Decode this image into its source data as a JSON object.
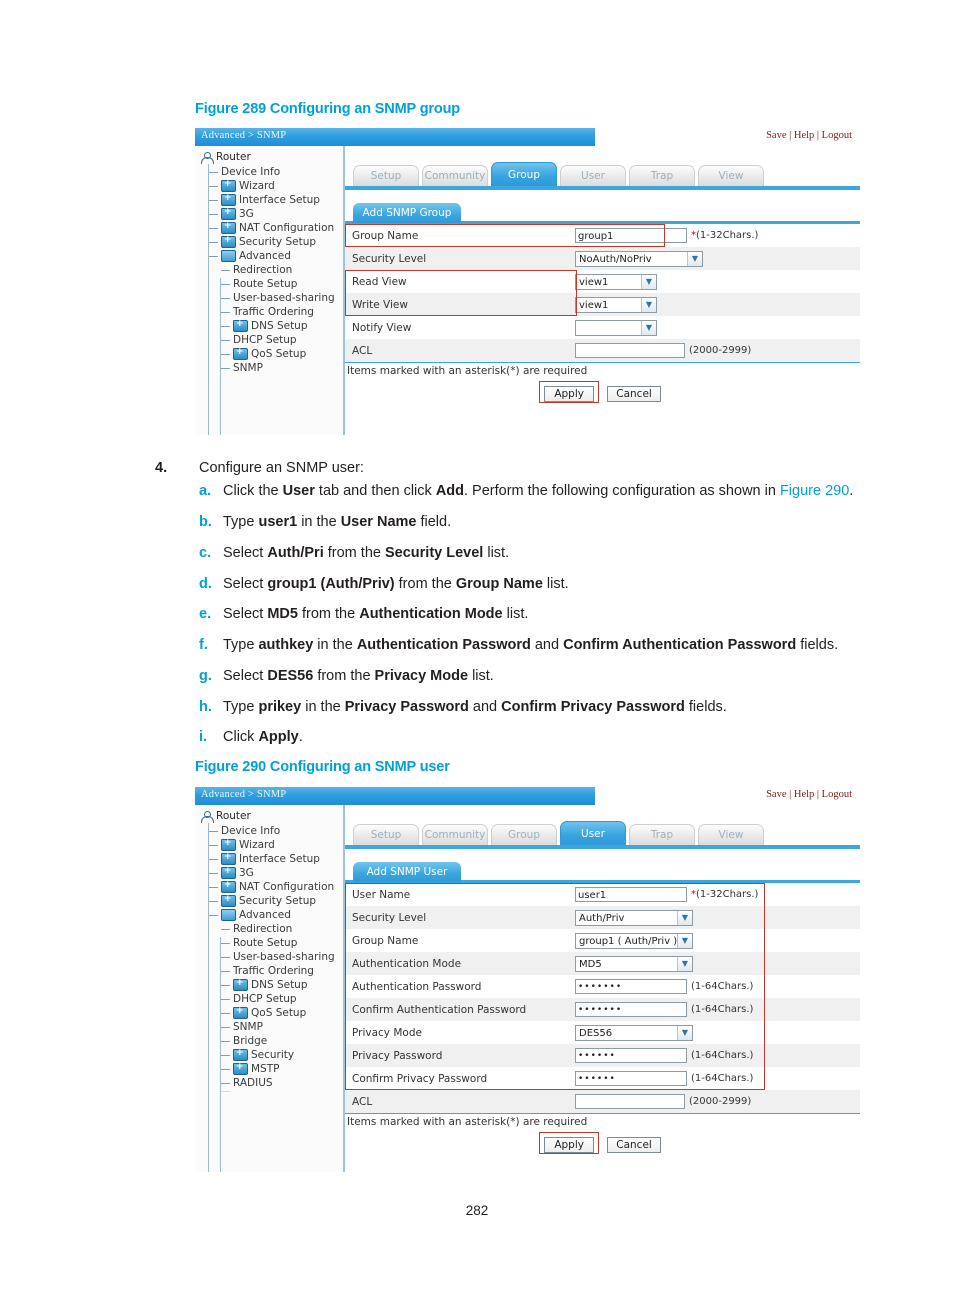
{
  "page": {
    "number": "282"
  },
  "figures": [
    {
      "caption": "Figure 289 Configuring an SNMP group",
      "breadcrumb": "Advanced > SNMP",
      "links": [
        "Save",
        "Help",
        "Logout"
      ],
      "link_separator": "|",
      "nav": {
        "root": "Router",
        "items": [
          {
            "label": "Device Info",
            "icon": "dash",
            "level": 1
          },
          {
            "label": "Wizard",
            "icon": "folder-plus",
            "level": 1
          },
          {
            "label": "Interface Setup",
            "icon": "folder-plus",
            "level": 1
          },
          {
            "label": "3G",
            "icon": "folder-plus",
            "level": 1
          },
          {
            "label": "NAT Configuration",
            "icon": "folder-plus",
            "level": 1
          },
          {
            "label": "Security Setup",
            "icon": "folder-plus",
            "level": 1
          },
          {
            "label": "Advanced",
            "icon": "folder-open",
            "level": 1
          },
          {
            "label": "Redirection",
            "icon": "dash",
            "level": 2
          },
          {
            "label": "Route Setup",
            "icon": "dash",
            "level": 2
          },
          {
            "label": "User-based-sharing",
            "icon": "dash",
            "level": 2
          },
          {
            "label": "Traffic Ordering",
            "icon": "dash",
            "level": 2
          },
          {
            "label": "DNS Setup",
            "icon": "folder-plus",
            "level": 2
          },
          {
            "label": "DHCP Setup",
            "icon": "dash",
            "level": 2
          },
          {
            "label": "QoS Setup",
            "icon": "folder-plus",
            "level": 2
          },
          {
            "label": "SNMP",
            "icon": "dash",
            "level": 2
          }
        ]
      },
      "tabs": [
        {
          "label": "Setup",
          "active": false
        },
        {
          "label": "Community",
          "active": false
        },
        {
          "label": "Group",
          "active": true
        },
        {
          "label": "User",
          "active": false
        },
        {
          "label": "Trap",
          "active": false
        },
        {
          "label": "View",
          "active": false
        }
      ],
      "subtab": "Add SNMP Group",
      "fields": [
        {
          "label": "Group Name",
          "type": "text",
          "value": "group1",
          "hint": "*(1-32Chars.)",
          "required": true
        },
        {
          "label": "Security Level",
          "type": "select",
          "value": "NoAuth/NoPriv",
          "hint": ""
        },
        {
          "label": "Read View",
          "type": "select",
          "value": "view1",
          "hint": ""
        },
        {
          "label": "Write View",
          "type": "select",
          "value": "view1",
          "hint": ""
        },
        {
          "label": "Notify View",
          "type": "select",
          "value": "",
          "hint": ""
        },
        {
          "label": "ACL",
          "type": "text",
          "value": "",
          "hint": "(2000-2999)"
        }
      ],
      "note": "Items marked with an asterisk(*) are required",
      "buttons": [
        {
          "label": "Apply",
          "highlighted": true
        },
        {
          "label": "Cancel",
          "highlighted": false
        }
      ]
    },
    {
      "caption": "Figure 290 Configuring an SNMP user",
      "breadcrumb": "Advanced > SNMP",
      "links": [
        "Save",
        "Help",
        "Logout"
      ],
      "link_separator": "|",
      "nav": {
        "root": "Router",
        "items": [
          {
            "label": "Device Info",
            "icon": "dash",
            "level": 1
          },
          {
            "label": "Wizard",
            "icon": "folder-plus",
            "level": 1
          },
          {
            "label": "Interface Setup",
            "icon": "folder-plus",
            "level": 1
          },
          {
            "label": "3G",
            "icon": "folder-plus",
            "level": 1
          },
          {
            "label": "NAT Configuration",
            "icon": "folder-plus",
            "level": 1
          },
          {
            "label": "Security Setup",
            "icon": "folder-plus",
            "level": 1
          },
          {
            "label": "Advanced",
            "icon": "folder-open",
            "level": 1
          },
          {
            "label": "Redirection",
            "icon": "dash",
            "level": 2
          },
          {
            "label": "Route Setup",
            "icon": "dash",
            "level": 2
          },
          {
            "label": "User-based-sharing",
            "icon": "dash",
            "level": 2
          },
          {
            "label": "Traffic Ordering",
            "icon": "dash",
            "level": 2
          },
          {
            "label": "DNS Setup",
            "icon": "folder-plus",
            "level": 2
          },
          {
            "label": "DHCP Setup",
            "icon": "dash",
            "level": 2
          },
          {
            "label": "QoS Setup",
            "icon": "folder-plus",
            "level": 2
          },
          {
            "label": "SNMP",
            "icon": "dash",
            "level": 2
          },
          {
            "label": "Bridge",
            "icon": "dash",
            "level": 2
          },
          {
            "label": "Security",
            "icon": "folder-plus",
            "level": 2
          },
          {
            "label": "MSTP",
            "icon": "folder-plus",
            "level": 2
          },
          {
            "label": "RADIUS",
            "icon": "dash",
            "level": 2
          }
        ]
      },
      "tabs": [
        {
          "label": "Setup",
          "active": false
        },
        {
          "label": "Community",
          "active": false
        },
        {
          "label": "Group",
          "active": false
        },
        {
          "label": "User",
          "active": true
        },
        {
          "label": "Trap",
          "active": false
        },
        {
          "label": "View",
          "active": false
        }
      ],
      "subtab": "Add SNMP User",
      "fields": [
        {
          "label": "User Name",
          "type": "text",
          "value": "user1",
          "hint": "*(1-32Chars.)",
          "required": true
        },
        {
          "label": "Security Level",
          "type": "select",
          "value": "Auth/Priv",
          "hint": ""
        },
        {
          "label": "Group Name",
          "type": "select",
          "value": "group1 ( Auth/Priv )",
          "hint": ""
        },
        {
          "label": "Authentication Mode",
          "type": "select",
          "value": "MD5",
          "hint": ""
        },
        {
          "label": "Authentication Password",
          "type": "password",
          "value": "•••••••",
          "hint": "(1-64Chars.)"
        },
        {
          "label": "Confirm Authentication Password",
          "type": "password",
          "value": "•••••••",
          "hint": "(1-64Chars.)"
        },
        {
          "label": "Privacy Mode",
          "type": "select",
          "value": "DES56",
          "hint": ""
        },
        {
          "label": "Privacy Password",
          "type": "password",
          "value": "••••••",
          "hint": "(1-64Chars.)"
        },
        {
          "label": "Confirm Privacy Password",
          "type": "password",
          "value": "••••••",
          "hint": "(1-64Chars.)"
        },
        {
          "label": "ACL",
          "type": "text",
          "value": "",
          "hint": "(2000-2999)"
        }
      ],
      "note": "Items marked with an asterisk(*) are required",
      "buttons": [
        {
          "label": "Apply",
          "highlighted": true
        },
        {
          "label": "Cancel",
          "highlighted": false
        }
      ]
    }
  ],
  "steps": {
    "number": "4.",
    "title": "Configure an SNMP user:",
    "substeps": [
      {
        "letter": "a.",
        "parts": [
          {
            "t": "Click the ",
            "s": "plain"
          },
          {
            "t": "User",
            "s": "bold"
          },
          {
            "t": " tab and then click ",
            "s": "plain"
          },
          {
            "t": "Add",
            "s": "bold"
          },
          {
            "t": ". Perform the following configuration as shown in ",
            "s": "plain"
          },
          {
            "t": "Figure 290",
            "s": "link"
          },
          {
            "t": ".",
            "s": "plain"
          }
        ]
      },
      {
        "letter": "b.",
        "parts": [
          {
            "t": "Type ",
            "s": "plain"
          },
          {
            "t": "user1",
            "s": "bold"
          },
          {
            "t": " in the ",
            "s": "plain"
          },
          {
            "t": "User Name",
            "s": "bold"
          },
          {
            "t": " field.",
            "s": "plain"
          }
        ]
      },
      {
        "letter": "c.",
        "parts": [
          {
            "t": "Select ",
            "s": "plain"
          },
          {
            "t": "Auth/Pri",
            "s": "bold"
          },
          {
            "t": " from the ",
            "s": "plain"
          },
          {
            "t": "Security Level",
            "s": "bold"
          },
          {
            "t": " list.",
            "s": "plain"
          }
        ]
      },
      {
        "letter": "d.",
        "parts": [
          {
            "t": "Select ",
            "s": "plain"
          },
          {
            "t": "group1 (Auth/Priv)",
            "s": "bold"
          },
          {
            "t": " from the ",
            "s": "plain"
          },
          {
            "t": "Group Name",
            "s": "bold"
          },
          {
            "t": " list.",
            "s": "plain"
          }
        ]
      },
      {
        "letter": "e.",
        "parts": [
          {
            "t": "Select ",
            "s": "plain"
          },
          {
            "t": "MD5",
            "s": "bold"
          },
          {
            "t": " from the ",
            "s": "plain"
          },
          {
            "t": "Authentication Mode",
            "s": "bold"
          },
          {
            "t": " list.",
            "s": "plain"
          }
        ]
      },
      {
        "letter": "f.",
        "parts": [
          {
            "t": "Type ",
            "s": "plain"
          },
          {
            "t": "authkey",
            "s": "bold"
          },
          {
            "t": " in the ",
            "s": "plain"
          },
          {
            "t": "Authentication Password",
            "s": "bold"
          },
          {
            "t": " and ",
            "s": "plain"
          },
          {
            "t": "Confirm Authentication Password",
            "s": "bold"
          },
          {
            "t": " fields.",
            "s": "plain"
          }
        ]
      },
      {
        "letter": "g.",
        "parts": [
          {
            "t": "Select ",
            "s": "plain"
          },
          {
            "t": "DES56",
            "s": "bold"
          },
          {
            "t": " from the ",
            "s": "plain"
          },
          {
            "t": "Privacy Mode",
            "s": "bold"
          },
          {
            "t": " list.",
            "s": "plain"
          }
        ]
      },
      {
        "letter": "h.",
        "parts": [
          {
            "t": "Type ",
            "s": "plain"
          },
          {
            "t": "prikey",
            "s": "bold"
          },
          {
            "t": " in the ",
            "s": "plain"
          },
          {
            "t": "Privacy Password",
            "s": "bold"
          },
          {
            "t": " and ",
            "s": "plain"
          },
          {
            "t": "Confirm Privacy Password",
            "s": "bold"
          },
          {
            "t": " fields.",
            "s": "plain"
          }
        ]
      },
      {
        "letter": "i.",
        "parts": [
          {
            "t": "Click ",
            "s": "plain"
          },
          {
            "t": "Apply",
            "s": "bold"
          },
          {
            "t": ".",
            "s": "plain"
          }
        ]
      }
    ]
  },
  "colors": {
    "accent_blue": "#00a0dd",
    "ui_blue": "#2e9ad8",
    "highlight_red": "#c0392b",
    "link_maroon": "#7b2222"
  }
}
